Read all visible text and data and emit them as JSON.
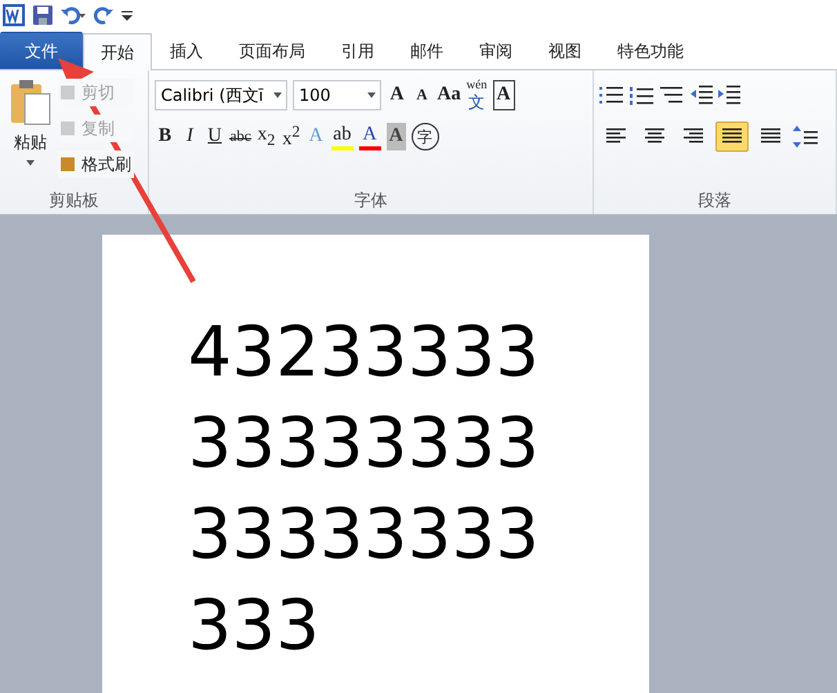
{
  "tabs": [
    {
      "label": "文件",
      "kind": "file",
      "selected": false
    },
    {
      "label": "开始",
      "kind": "tab",
      "selected": true
    },
    {
      "label": "插入",
      "kind": "tab",
      "selected": false
    },
    {
      "label": "页面布局",
      "kind": "tab",
      "selected": false
    },
    {
      "label": "引用",
      "kind": "tab",
      "selected": false
    },
    {
      "label": "邮件",
      "kind": "tab",
      "selected": false
    },
    {
      "label": "审阅",
      "kind": "tab",
      "selected": false
    },
    {
      "label": "视图",
      "kind": "tab",
      "selected": false
    },
    {
      "label": "特色功能",
      "kind": "tab",
      "selected": false
    }
  ],
  "clipboard": {
    "paste": "粘贴",
    "title": "剪贴板",
    "items": [
      {
        "label": "剪切",
        "disabled": true
      },
      {
        "label": "复制",
        "disabled": true
      },
      {
        "label": "格式刷",
        "disabled": false
      }
    ]
  },
  "font": {
    "family": "Calibri (西文ī",
    "size": "100",
    "title": "字体",
    "row1": [
      {
        "label": "A",
        "kind": "grow"
      },
      {
        "label": "A",
        "kind": "shrink"
      },
      {
        "label": "Aa",
        "kind": "case"
      },
      {
        "label": "wén",
        "kind": "pinyin",
        "sub": "文"
      },
      {
        "label": "A",
        "kind": "border"
      }
    ],
    "row2": [
      {
        "label": "B",
        "kind": "bold"
      },
      {
        "label": "I",
        "kind": "italic"
      },
      {
        "label": "U",
        "kind": "underline"
      },
      {
        "label": "abc",
        "kind": "strike"
      },
      {
        "label": "x$_{2}$",
        "kind": "plain"
      },
      {
        "label": "x$^{2}$",
        "kind": "plain"
      },
      {
        "label": "A",
        "kind": "effect"
      },
      {
        "label": "ab",
        "kind": "highlight",
        "color": "#ffff00"
      },
      {
        "label": "A",
        "kind": "fontcolor",
        "color": "#ff0000"
      },
      {
        "label": "A",
        "kind": "shade"
      },
      {
        "label": "字",
        "kind": "circle"
      }
    ]
  },
  "paragraph": {
    "title": "段落",
    "align": [
      {
        "selected": false
      },
      {
        "selected": false
      },
      {
        "selected": false
      },
      {
        "selected": true
      },
      {
        "selected": false
      }
    ]
  },
  "document": {
    "lines": [
      "43233333",
      "33333333",
      "33333333",
      "333"
    ]
  }
}
